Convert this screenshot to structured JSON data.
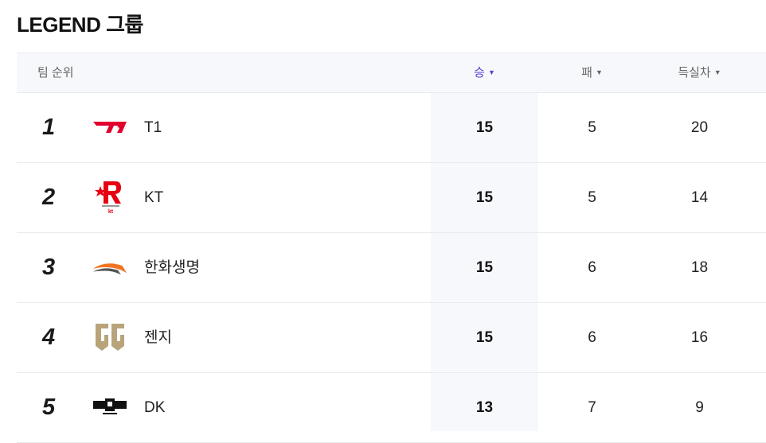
{
  "group_title": "LEGEND 그룹",
  "header": {
    "rank_label": "팀 순위",
    "win_label": "승",
    "lose_label": "패",
    "diff_label": "득실차",
    "sort_arrow": "▼"
  },
  "colors": {
    "active_sort": "#5b3fd6"
  },
  "rows": [
    {
      "rank": "1",
      "team": "T1",
      "logo_icon": "t1-logo-icon",
      "win": "15",
      "lose": "5",
      "diff": "20"
    },
    {
      "rank": "2",
      "team": "KT",
      "logo_icon": "kt-rolster-logo-icon",
      "logo_text": "kt",
      "win": "15",
      "lose": "5",
      "diff": "14"
    },
    {
      "rank": "3",
      "team": "한화생명",
      "logo_icon": "hanwha-life-logo-icon",
      "win": "15",
      "lose": "6",
      "diff": "18"
    },
    {
      "rank": "4",
      "team": "젠지",
      "logo_icon": "gen-g-logo-icon",
      "win": "15",
      "lose": "6",
      "diff": "16"
    },
    {
      "rank": "5",
      "team": "DK",
      "logo_icon": "dk-logo-icon",
      "win": "13",
      "lose": "7",
      "diff": "9"
    }
  ]
}
